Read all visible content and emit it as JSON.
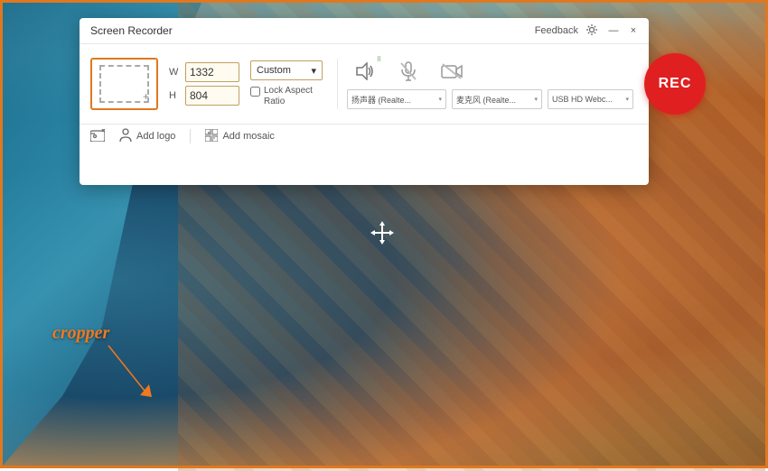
{
  "app": {
    "title": "Screen Recorder",
    "feedback_label": "Feedback",
    "close_label": "×",
    "minimize_label": "—"
  },
  "toolbar": {
    "add_logo_label": "Add logo",
    "add_mosaic_label": "Add mosaic"
  },
  "crop": {
    "width_label": "W",
    "height_label": "H",
    "width_value": "1332",
    "height_value": "804",
    "preset_label": "Custom",
    "lock_ratio_label": "Lock Aspect Ratio"
  },
  "audio": {
    "speaker_dropdown_label": "扬声器 (Realte...",
    "mic_dropdown_label": "麦克风 (Realte...",
    "camera_dropdown_label": "USB HD Webc..."
  },
  "rec_button": {
    "label": "REC"
  },
  "cropper_annotation": {
    "label": "cropper"
  },
  "colors": {
    "orange_border": "#e07820",
    "rec_red": "#e02020",
    "accent_orange": "#f07820"
  }
}
